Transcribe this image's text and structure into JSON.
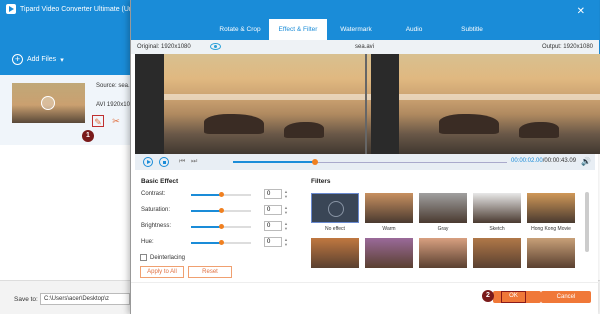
{
  "app": {
    "title": "Tipard Video Converter Ultimate (Unre",
    "add_files_label": "Add Files",
    "file_source": "Source: sea.",
    "file_meta": "AVI  1920x10",
    "save_to_label": "Save to:",
    "save_to_path": "C:\\Users\\acer\\Desktop\\z",
    "badge1": "1",
    "badge2": "2"
  },
  "dialog": {
    "tabs": [
      "Rotate & Crop",
      "Effect & Filter",
      "Watermark",
      "Audio",
      "Subtitle"
    ],
    "active_tab": 1,
    "original_label": "Original: 1920x1080",
    "file_name": "sea.avi",
    "output_label": "Output: 1920x1080",
    "time_current": "00:00:02.00",
    "time_total": "/00:00:43.09",
    "playback_progress": 0.3
  },
  "basic_effect": {
    "title": "Basic Effect",
    "params": [
      {
        "label": "Contrast:",
        "value": "0",
        "level": 0.5
      },
      {
        "label": "Saturation:",
        "value": "0",
        "level": 0.5
      },
      {
        "label": "Brightness:",
        "value": "0",
        "level": 0.5
      },
      {
        "label": "Hue:",
        "value": "0",
        "level": 0.5
      }
    ],
    "deinterlacing_label": "Deinterlacing",
    "apply_all_label": "Apply to All",
    "reset_label": "Reset"
  },
  "filters": {
    "title": "Filters",
    "row1": [
      "No effect",
      "Warm",
      "Gray",
      "Sketch",
      "Hong Kong Movie"
    ],
    "row1_colors": [
      "#3a4656",
      "#c89060",
      "#a0a0a0",
      "#e8e8e8",
      "#d09858"
    ],
    "row2_colors": [
      "#c07840",
      "#9a6a9a",
      "#d8a080",
      "#b07848",
      "#c8a078"
    ]
  },
  "footer": {
    "ok_label": "OK",
    "cancel_label": "Cancel"
  }
}
